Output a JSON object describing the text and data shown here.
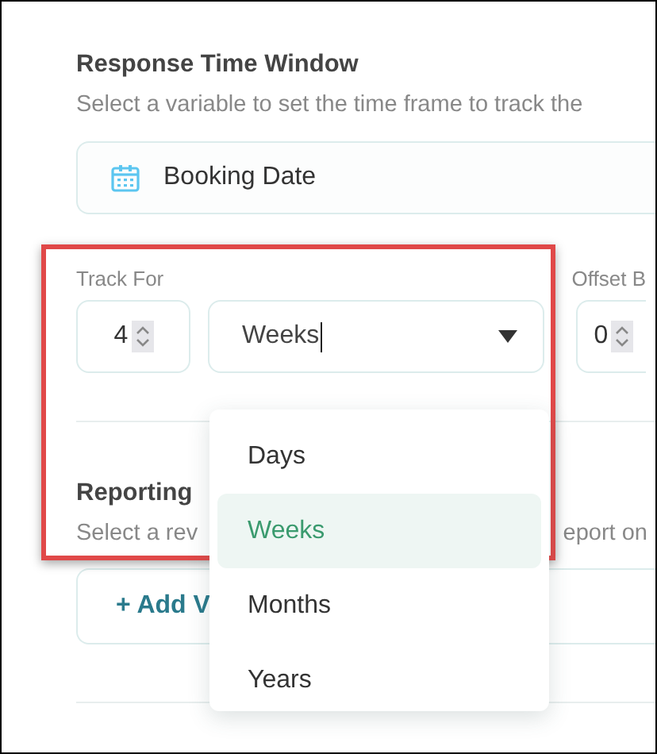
{
  "response_window": {
    "title": "Response Time Window",
    "description": "Select a variable to set the time frame to track the",
    "variable": {
      "label": "Booking Date"
    }
  },
  "track_for": {
    "label": "Track For",
    "value": "4",
    "unit": "Weeks",
    "menu_open": true,
    "options": [
      {
        "label": "Days",
        "selected": false
      },
      {
        "label": "Weeks",
        "selected": true
      },
      {
        "label": "Months",
        "selected": false
      },
      {
        "label": "Years",
        "selected": false
      }
    ]
  },
  "offset": {
    "label": "Offset B",
    "value": "0"
  },
  "reporting": {
    "title": "Reporting",
    "description_start": "Select a rev",
    "description_end": "eport on",
    "add_button": "+ Add V"
  },
  "highlight": {
    "shown": true
  }
}
